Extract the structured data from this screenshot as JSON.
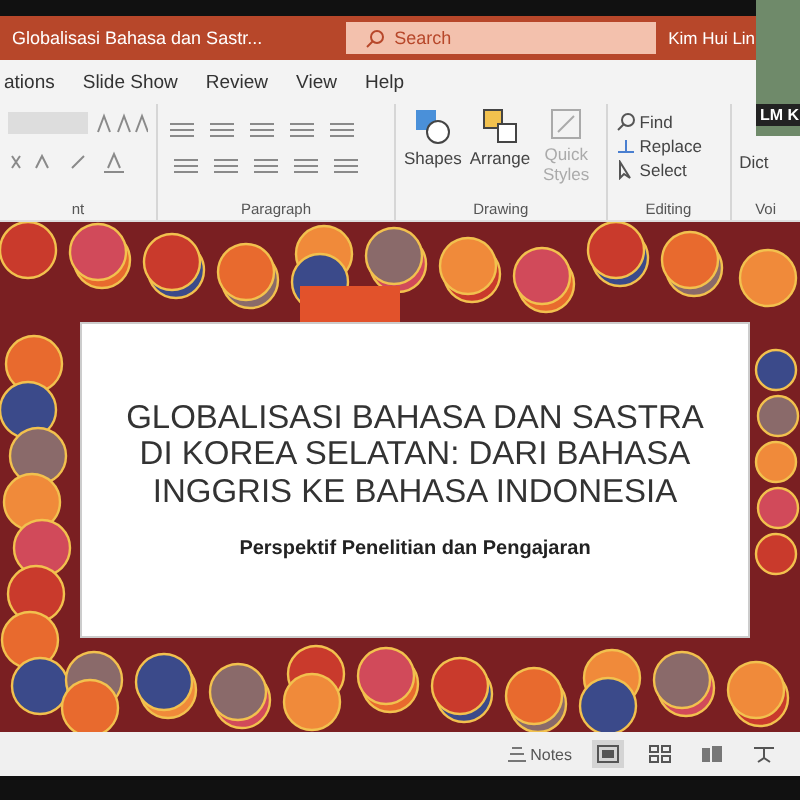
{
  "title_bar": {
    "document_title": "Globalisasi Bahasa dan Sastr...",
    "search": {
      "placeholder": "Search"
    },
    "user": "Kim Hui Lin"
  },
  "ribbon_tabs": [
    "ations",
    "Slide Show",
    "Review",
    "View",
    "Help"
  ],
  "ribbon_groups": [
    {
      "kind": "font",
      "label": "nt"
    },
    {
      "kind": "paragraph",
      "label": "Paragraph"
    },
    {
      "kind": "drawing",
      "label": "Drawing",
      "buttons": [
        "Shapes",
        "Arrange",
        "Quick Styles"
      ]
    },
    {
      "kind": "editing",
      "label": "Editing",
      "buttons": [
        "Find",
        "Replace",
        "Select"
      ]
    },
    {
      "kind": "voice",
      "label": "Voi",
      "buttons": [
        "Dict"
      ]
    }
  ],
  "slide": {
    "title": "GLOBALISASI BAHASA DAN SASTRA DI KOREA SELATAN: DARI BAHASA INGGRIS KE BAHASA INDONESIA",
    "subtitle": "Perspektif Penelitian dan Pengajaran"
  },
  "status_bar": {
    "notes": "Notes"
  },
  "video_overlay": {
    "name": "LM K"
  }
}
